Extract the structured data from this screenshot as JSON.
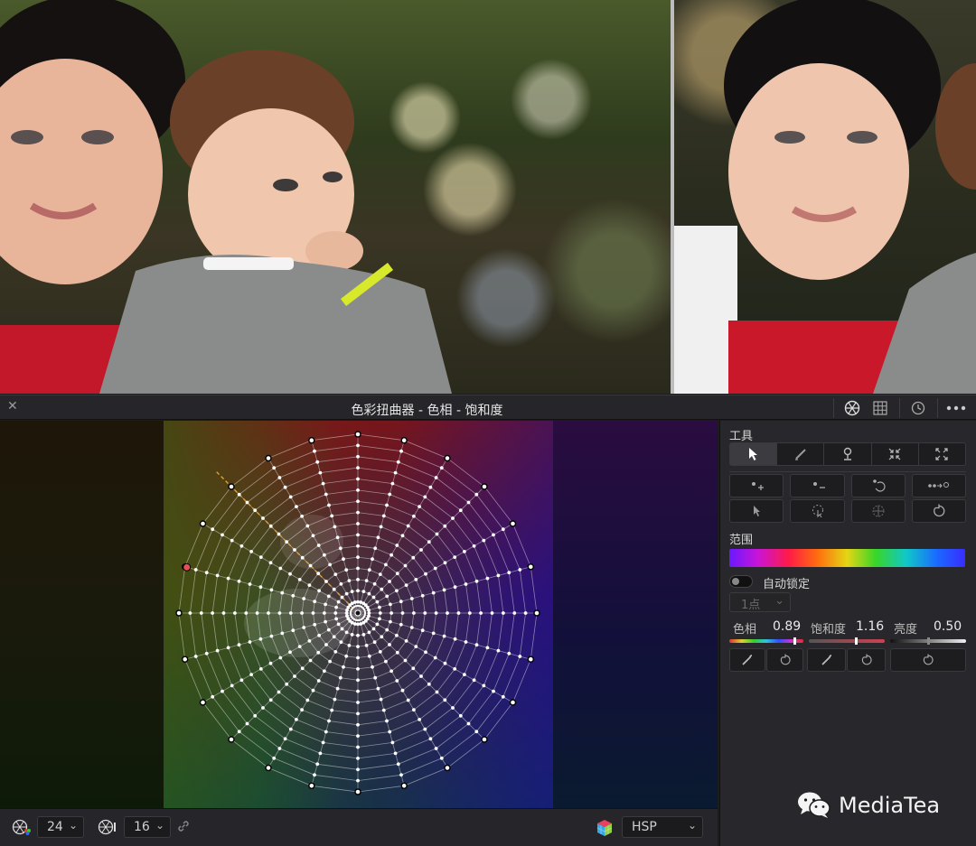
{
  "panel": {
    "title": "色彩扭曲器 - 色相 - 饱和度",
    "close_label": "✕"
  },
  "toolbar_icons": [
    "warper-icon",
    "grid-icon",
    "history-icon",
    "more-icon"
  ],
  "tools": {
    "header": "工具",
    "icons": [
      "pointer-icon",
      "brush-icon",
      "pin-icon",
      "collapse-icon",
      "expand-icon"
    ],
    "row2_icons": [
      "add-point-icon",
      "remove-point-icon",
      "swap-point-icon",
      "connect-icon"
    ],
    "row3_icons": [
      "select-icon",
      "lasso-icon",
      "target-icon",
      "reset-icon"
    ]
  },
  "range": {
    "header": "范围",
    "auto_lock_label": "自动锁定",
    "points_placeholder": "1点",
    "auto_lock_on": false
  },
  "adjust": {
    "hue_label": "色相",
    "hue_value": "0.89",
    "sat_label": "饱和度",
    "sat_value": "1.16",
    "lum_label": "亮度",
    "lum_value": "0.50",
    "hue_marker": 0.89,
    "sat_marker": 0.62,
    "lum_marker": 0.5
  },
  "bottom": {
    "hue_resolution": "24",
    "sat_resolution": "16",
    "color_space": "HSP"
  },
  "watermark": {
    "text": "MediaTea"
  },
  "colors": {
    "accent_red": "#e25050",
    "guide_orange": "#e8a030",
    "panel_bg": "#28282c"
  }
}
